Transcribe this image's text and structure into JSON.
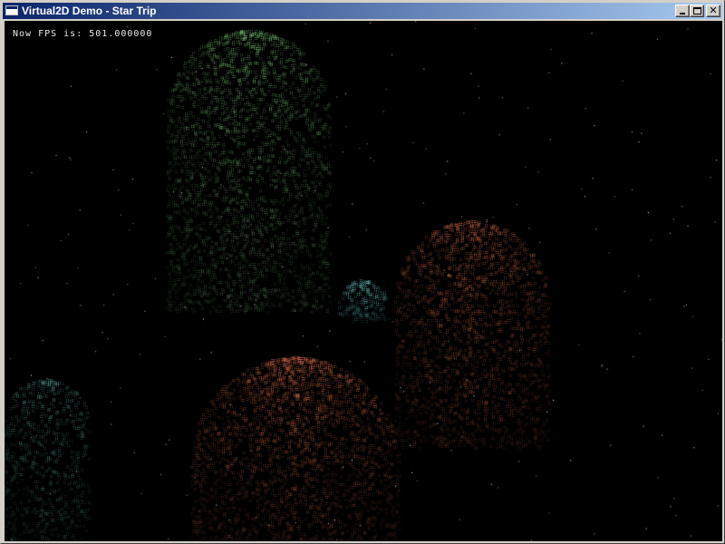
{
  "window": {
    "title": "Virtual2D Demo - Star Trip",
    "minimize_label": "",
    "maximize_label": "",
    "close_label": "✕"
  },
  "hud": {
    "fps_text": "Now FPS is: 501.000000"
  },
  "scene": {
    "background_color": "#000000",
    "cluster_colors": {
      "green": "#7fd07a",
      "orange": "#e0704a",
      "cyan": "#7fe0e0",
      "teal": "#5fb0a0"
    }
  }
}
